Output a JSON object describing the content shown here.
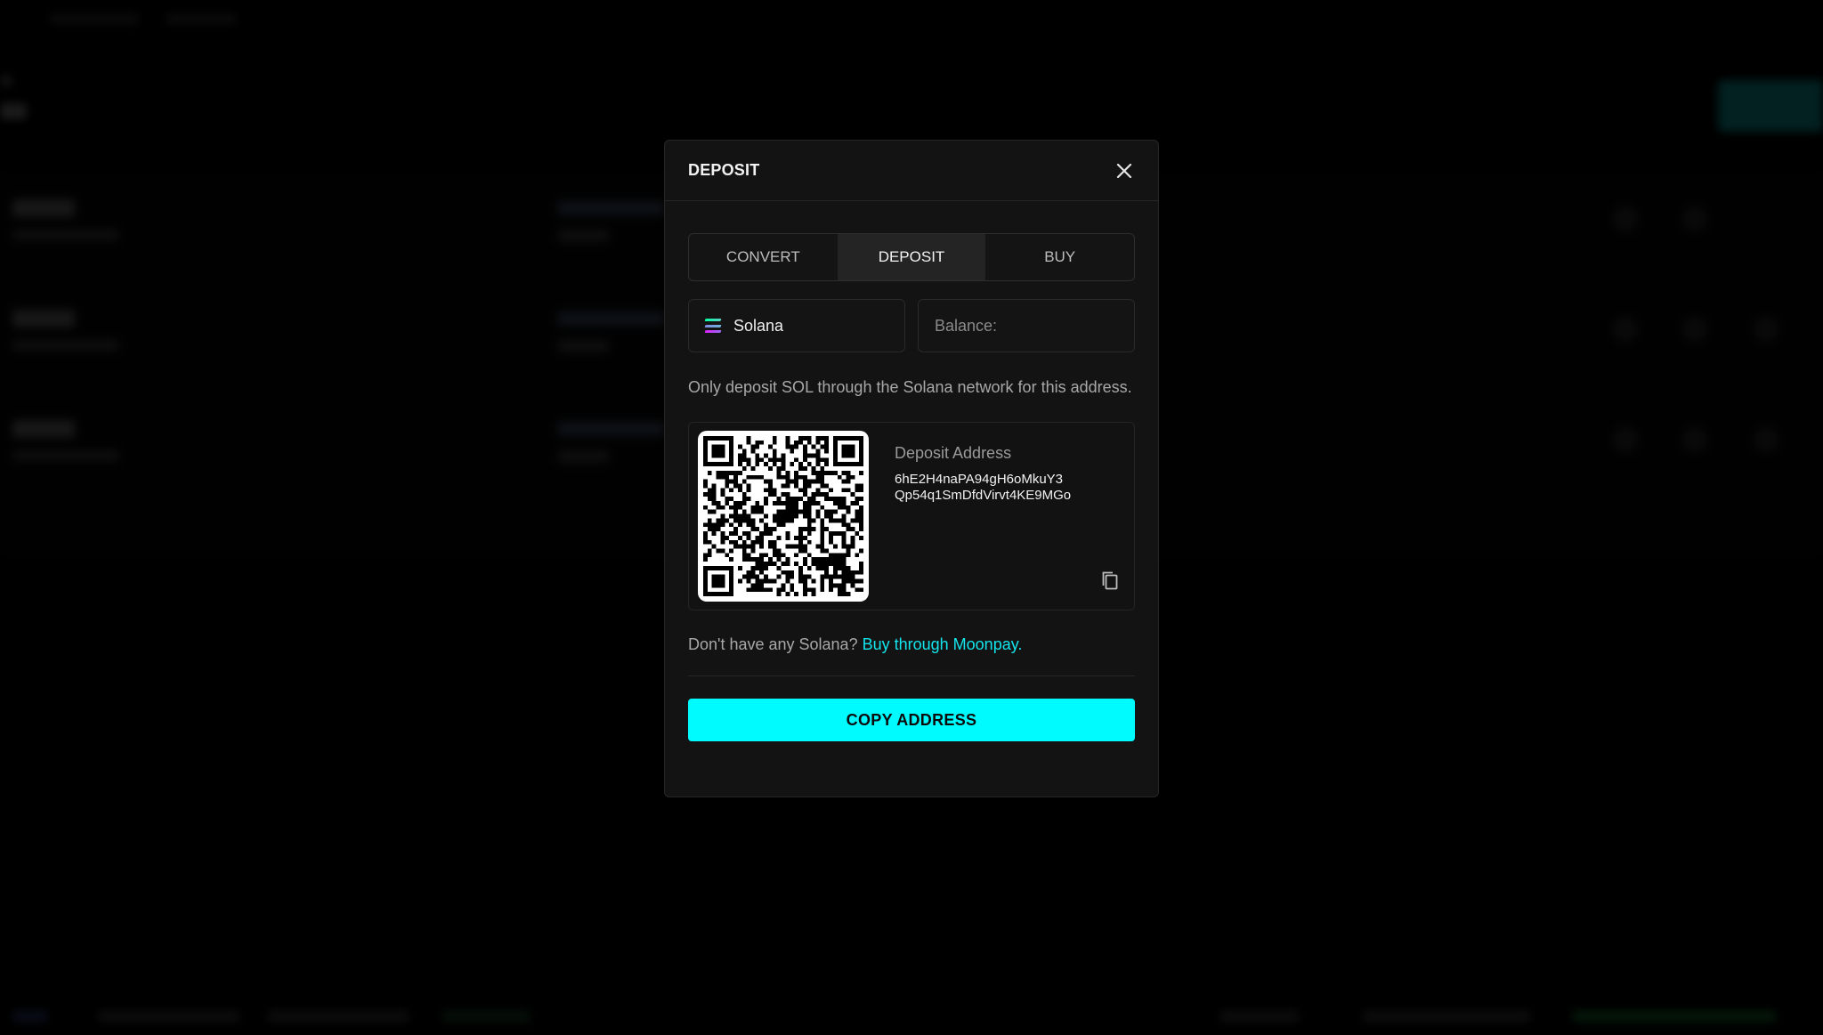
{
  "modal": {
    "title": "DEPOSIT",
    "tabs": [
      {
        "label": "CONVERT"
      },
      {
        "label": "DEPOSIT",
        "active": true
      },
      {
        "label": "BUY"
      }
    ],
    "network": {
      "value": "Solana",
      "icon": "solana-icon"
    },
    "balance": {
      "label": "Balance:"
    },
    "note": "Only deposit SOL through the Solana network for this address.",
    "deposit": {
      "label": "Deposit Address",
      "address": "6hE2H4naPA94gH6oMkuY3Qp54q1SmDfdVirvt4KE9MGo"
    },
    "buy_prompt": "Don't have any Solana?",
    "buy_link": "Buy through Moonpay.",
    "copy_button": "COPY ADDRESS"
  },
  "colors": {
    "accent": "#00fbff",
    "link": "#14e4ec",
    "modal_bg": "#131313"
  }
}
